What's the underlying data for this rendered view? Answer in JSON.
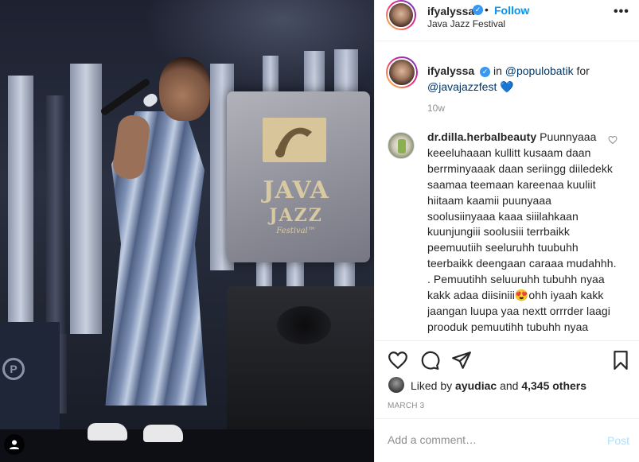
{
  "photo": {
    "sign_java": "JAVA",
    "sign_jazz": "JAZZ",
    "sign_festival": "Festival™",
    "stage_logo": "P"
  },
  "header": {
    "username": "ifyalyssa",
    "separator": "•",
    "follow_label": "Follow",
    "location": "Java Jazz Festival",
    "more_label": "•••"
  },
  "caption": {
    "username": "ifyalyssa",
    "text_in": "in",
    "mention_brand": "@populobatik",
    "text_for": "for",
    "mention_fest": "@javajazzfest",
    "emoji": "💙",
    "time": "10w"
  },
  "comment": {
    "username": "dr.dilla.herbalbeauty",
    "text": "Puunnyaaa keeeluhaaan kullitt kusaam daan berrminyaaak daan seriingg diiledekk saamaa teemaan kareenaa kuuliit hiitaam kaamii puunyaaa soolusiinyaaa kaaa siiilahkaan kuunjungiii soolusiii terrbaikk peemuutiih seeluruhh tuubuhh teerbaikk deengaan caraaa mudahhh. . Pemuutihh seluuruhh tubuhh nyaa kakk adaa diisiniii",
    "emoji": "😍",
    "text2": "ohh iyaah kakk jaangan luupa yaa nextt orrrder laagi prooduk pemuutihh tubuhh nyaa"
  },
  "likes": {
    "prefix": "Liked by",
    "user": "ayudiac",
    "conjunction": "and",
    "count": "4,345 others"
  },
  "post_date": "MARCH 3",
  "add_comment": {
    "placeholder": "Add a comment…",
    "post_label": "Post"
  },
  "icons": {
    "verified": "verified-badge-icon",
    "like": "heart-icon",
    "comment": "comment-bubble-icon",
    "share": "paper-plane-icon",
    "save": "bookmark-icon",
    "user_tag": "person-tag-icon",
    "comment_like": "small-heart-icon"
  },
  "colors": {
    "accent": "#0095f6",
    "text": "#262626",
    "muted": "#8e8e8e",
    "post_disabled": "#b2dffc",
    "verified": "#3897f0"
  }
}
